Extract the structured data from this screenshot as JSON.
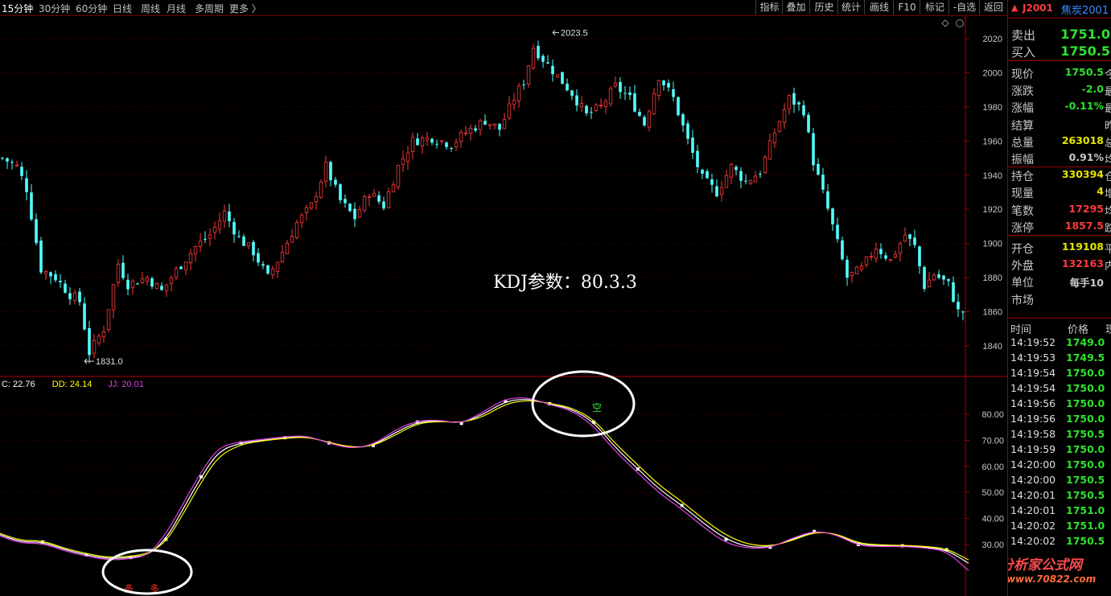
{
  "timeframes": [
    {
      "label": "15分钟",
      "active": true
    },
    {
      "label": "30分钟"
    },
    {
      "label": "60分钟"
    },
    {
      "label": "日线"
    },
    {
      "label": "周线"
    },
    {
      "label": "月线"
    },
    {
      "label": "多周期"
    },
    {
      "label": "更多 〉"
    }
  ],
  "toolbar": [
    "指标",
    "叠加",
    "历史",
    "统计",
    "画线",
    "F10",
    "标记",
    "-自选",
    "返回"
  ],
  "symbol": {
    "arrow": "▲",
    "code": "J2001",
    "name": "焦炭2001"
  },
  "quote_top": [
    {
      "label": "卖出",
      "value": "1751.0",
      "color": "#2ee12e"
    },
    {
      "label": "买入",
      "value": "1750.5",
      "color": "#2ee12e"
    }
  ],
  "quote_rows": [
    {
      "label": "现价",
      "value": "1750.5",
      "color": "#2ee12e",
      "extra": "今"
    },
    {
      "label": "涨跌",
      "value": "-2.0",
      "color": "#2ee12e",
      "extra": "最"
    },
    {
      "label": "涨幅",
      "value": "-0.11%",
      "color": "#2ee12e",
      "extra": "最"
    },
    {
      "label": "结算",
      "value": "",
      "color": "#c8c8c8",
      "extra": "昨"
    },
    {
      "label": "总量",
      "value": "263018",
      "color": "#e6e600",
      "extra": "总"
    },
    {
      "label": "振幅",
      "value": "0.91%",
      "color": "#c8c8c8",
      "extra": "均"
    },
    {
      "label": "持仓",
      "value": "330394",
      "color": "#e6e600",
      "extra": "仓"
    },
    {
      "label": "现量",
      "value": "4",
      "color": "#e6e600",
      "extra": "增"
    },
    {
      "label": "笔数",
      "value": "17295",
      "color": "#ff3a3a",
      "extra": "均"
    },
    {
      "label": "涨停",
      "value": "1857.5",
      "color": "#ff3a3a",
      "extra": "跌"
    },
    {
      "label": "开仓",
      "value": "119108",
      "color": "#e6e600",
      "extra": "平"
    },
    {
      "label": "外盘",
      "value": "132163",
      "color": "#ff3a3a",
      "extra": "内"
    },
    {
      "label": "单位",
      "value": "每手10",
      "color": "#c8c8c8",
      "extra": ""
    },
    {
      "label": "市场",
      "value": "",
      "color": "#c8c8c8",
      "extra": ""
    }
  ],
  "tick_header": {
    "time": "时间",
    "price": "价格",
    "extra": "现"
  },
  "ticks": [
    {
      "time": "14:19:52",
      "price": "1749.0",
      "dir": "down"
    },
    {
      "time": "14:19:53",
      "price": "1749.5",
      "dir": "down"
    },
    {
      "time": "14:19:54",
      "price": "1750.0",
      "dir": "down"
    },
    {
      "time": "14:19:54",
      "price": "1750.0",
      "dir": "down"
    },
    {
      "time": "14:19:56",
      "price": "1750.0",
      "dir": "down"
    },
    {
      "time": "14:19:56",
      "price": "1750.0",
      "dir": "down"
    },
    {
      "time": "14:19:58",
      "price": "1750.5",
      "dir": "down"
    },
    {
      "time": "14:19:59",
      "price": "1750.0",
      "dir": "down"
    },
    {
      "time": "14:20:00",
      "price": "1750.0",
      "dir": "down"
    },
    {
      "time": "14:20:00",
      "price": "1750.5",
      "dir": "down"
    },
    {
      "time": "14:20:01",
      "price": "1750.5",
      "dir": "down"
    },
    {
      "time": "14:20:01",
      "price": "1751.0",
      "dir": "down"
    },
    {
      "time": "14:20:02",
      "price": "1751.0",
      "dir": "down"
    },
    {
      "time": "14:20:02",
      "price": "1750.5",
      "dir": "down"
    }
  ],
  "annotation": "KDJ参数：80.3.3",
  "watermark": {
    "text": "分析家公式网",
    "url": "www.70822.com"
  },
  "price_labels": {
    "high": "2023.5",
    "low": "1831.0"
  },
  "kdj_legend": [
    {
      "text": "C: 22.76",
      "color": "#ffffff"
    },
    {
      "text": "DD: 24.14",
      "color": "#ffff00"
    },
    {
      "text": "JJ: 20.01",
      "color": "#e040e0"
    }
  ],
  "signals": {
    "short": "空",
    "long1": "多",
    "long2": "多"
  },
  "chart_data": [
    {
      "type": "candlestick",
      "y_ticks": [
        2020,
        2000,
        1980,
        1960,
        1940,
        1920,
        1900,
        1880,
        1860,
        1840
      ],
      "ylim": [
        1828,
        2032
      ],
      "high_label": 2023.5,
      "low_label": 1831.0,
      "close_path": [
        [
          0,
          1950
        ],
        [
          3,
          1945
        ],
        [
          5,
          1932
        ],
        [
          8,
          1885
        ],
        [
          11,
          1880
        ],
        [
          14,
          1870
        ],
        [
          16,
          1866
        ],
        [
          18,
          1836
        ],
        [
          21,
          1850
        ],
        [
          24,
          1888
        ],
        [
          26,
          1876
        ],
        [
          30,
          1880
        ],
        [
          33,
          1872
        ],
        [
          36,
          1884
        ],
        [
          40,
          1898
        ],
        [
          43,
          1905
        ],
        [
          46,
          1918
        ],
        [
          49,
          1903
        ],
        [
          52,
          1895
        ],
        [
          55,
          1880
        ],
        [
          58,
          1895
        ],
        [
          61,
          1912
        ],
        [
          64,
          1922
        ],
        [
          67,
          1945
        ],
        [
          70,
          1925
        ],
        [
          73,
          1915
        ],
        [
          76,
          1930
        ],
        [
          79,
          1922
        ],
        [
          82,
          1945
        ],
        [
          85,
          1960
        ],
        [
          89,
          1962
        ],
        [
          93,
          1958
        ],
        [
          96,
          1965
        ],
        [
          100,
          1972
        ],
        [
          103,
          1967
        ],
        [
          106,
          1985
        ],
        [
          108,
          1995
        ],
        [
          110,
          2015
        ],
        [
          112,
          2008
        ],
        [
          115,
          1998
        ],
        [
          118,
          1988
        ],
        [
          121,
          1975
        ],
        [
          124,
          1980
        ],
        [
          127,
          1992
        ],
        [
          130,
          1985
        ],
        [
          133,
          1970
        ],
        [
          136,
          1998
        ],
        [
          139,
          1985
        ],
        [
          142,
          1960
        ],
        [
          145,
          1938
        ],
        [
          148,
          1930
        ],
        [
          151,
          1945
        ],
        [
          154,
          1936
        ],
        [
          157,
          1942
        ],
        [
          160,
          1965
        ],
        [
          163,
          1985
        ],
        [
          166,
          1978
        ],
        [
          168,
          1948
        ],
        [
          171,
          1920
        ],
        [
          173,
          1900
        ],
        [
          175,
          1880
        ],
        [
          178,
          1885
        ],
        [
          181,
          1898
        ],
        [
          184,
          1890
        ],
        [
          187,
          1905
        ],
        [
          189,
          1898
        ],
        [
          191,
          1875
        ],
        [
          193,
          1882
        ],
        [
          196,
          1876
        ],
        [
          198,
          1860
        ]
      ]
    },
    {
      "type": "line",
      "name": "KDJ",
      "y_ticks": [
        80,
        70,
        60,
        50,
        40,
        30
      ],
      "ylim": [
        21,
        91
      ],
      "series": [
        {
          "name": "C",
          "color": "#ffffff",
          "values": [
            [
              0,
              34
            ],
            [
              5,
              31
            ],
            [
              10,
              31
            ],
            [
              15,
              28
            ],
            [
              20,
              26
            ],
            [
              25,
              24.5
            ],
            [
              30,
              25
            ],
            [
              34,
              26
            ],
            [
              38,
              32
            ],
            [
              42,
              44
            ],
            [
              46,
              56
            ],
            [
              50,
              66
            ],
            [
              55,
              69
            ],
            [
              60,
              70
            ],
            [
              65,
              71
            ],
            [
              70,
              71.5
            ],
            [
              75,
              69
            ],
            [
              80,
              67
            ],
            [
              85,
              68
            ],
            [
              90,
              73
            ],
            [
              95,
              77
            ],
            [
              100,
              77.5
            ],
            [
              105,
              76.5
            ],
            [
              110,
              80
            ],
            [
              115,
              85
            ],
            [
              120,
              86
            ],
            [
              125,
              84
            ],
            [
              130,
              82
            ],
            [
              135,
              77
            ],
            [
              140,
              67
            ],
            [
              145,
              59
            ],
            [
              150,
              51
            ],
            [
              155,
              45
            ],
            [
              160,
              38
            ],
            [
              165,
              32
            ],
            [
              170,
              29
            ],
            [
              175,
              29
            ],
            [
              180,
              32
            ],
            [
              185,
              35
            ],
            [
              190,
              34
            ],
            [
              195,
              30
            ],
            [
              200,
              29.5
            ],
            [
              205,
              29.5
            ],
            [
              210,
              29
            ],
            [
              215,
              28
            ],
            [
              220,
              22.8
            ]
          ]
        },
        {
          "name": "DD",
          "color": "#ffff00",
          "values": [
            [
              0,
              34.5
            ],
            [
              5,
              31.5
            ],
            [
              10,
              31.5
            ],
            [
              15,
              28.5
            ],
            [
              20,
              26.5
            ],
            [
              25,
              25
            ],
            [
              30,
              25.5
            ],
            [
              34,
              26.5
            ],
            [
              38,
              31
            ],
            [
              42,
              42
            ],
            [
              46,
              54
            ],
            [
              50,
              64
            ],
            [
              55,
              68.5
            ],
            [
              60,
              69.8
            ],
            [
              65,
              70.8
            ],
            [
              70,
              71.3
            ],
            [
              75,
              69.2
            ],
            [
              80,
              67.3
            ],
            [
              85,
              67.8
            ],
            [
              90,
              72
            ],
            [
              95,
              76.5
            ],
            [
              100,
              77.3
            ],
            [
              105,
              76.8
            ],
            [
              110,
              79
            ],
            [
              115,
              84
            ],
            [
              120,
              85.5
            ],
            [
              125,
              84.2
            ],
            [
              130,
              82.5
            ],
            [
              135,
              78
            ],
            [
              140,
              68.5
            ],
            [
              145,
              60.5
            ],
            [
              150,
              52.5
            ],
            [
              155,
              46.5
            ],
            [
              160,
              39.5
            ],
            [
              165,
              33.5
            ],
            [
              170,
              30
            ],
            [
              175,
              29.3
            ],
            [
              180,
              31.5
            ],
            [
              185,
              34.8
            ],
            [
              190,
              34.2
            ],
            [
              195,
              30.5
            ],
            [
              200,
              29.8
            ],
            [
              205,
              29.7
            ],
            [
              210,
              29.3
            ],
            [
              215,
              28.5
            ],
            [
              220,
              24.1
            ]
          ]
        },
        {
          "name": "JJ",
          "color": "#e040e0",
          "values": [
            [
              0,
              33.5
            ],
            [
              5,
              30.5
            ],
            [
              10,
              30.5
            ],
            [
              15,
              27.5
            ],
            [
              20,
              25.5
            ],
            [
              25,
              24
            ],
            [
              30,
              24.5
            ],
            [
              34,
              26
            ],
            [
              38,
              34
            ],
            [
              42,
              46
            ],
            [
              46,
              58
            ],
            [
              50,
              67.5
            ],
            [
              55,
              69.5
            ],
            [
              60,
              70.4
            ],
            [
              65,
              71.4
            ],
            [
              70,
              71.8
            ],
            [
              75,
              68.8
            ],
            [
              80,
              66.8
            ],
            [
              85,
              68.3
            ],
            [
              90,
              74
            ],
            [
              95,
              77.6
            ],
            [
              100,
              77.8
            ],
            [
              105,
              76.3
            ],
            [
              110,
              81
            ],
            [
              115,
              86
            ],
            [
              120,
              86.5
            ],
            [
              125,
              83.6
            ],
            [
              130,
              81.5
            ],
            [
              135,
              75.5
            ],
            [
              140,
              65.5
            ],
            [
              145,
              57.5
            ],
            [
              150,
              49.5
            ],
            [
              155,
              43.5
            ],
            [
              160,
              36.5
            ],
            [
              165,
              30.5
            ],
            [
              170,
              28.5
            ],
            [
              175,
              28.7
            ],
            [
              180,
              32.5
            ],
            [
              185,
              35.3
            ],
            [
              190,
              33.8
            ],
            [
              195,
              29.5
            ],
            [
              200,
              29.2
            ],
            [
              205,
              29.3
            ],
            [
              210,
              28.7
            ],
            [
              215,
              27.5
            ],
            [
              220,
              20.0
            ]
          ]
        }
      ]
    }
  ]
}
